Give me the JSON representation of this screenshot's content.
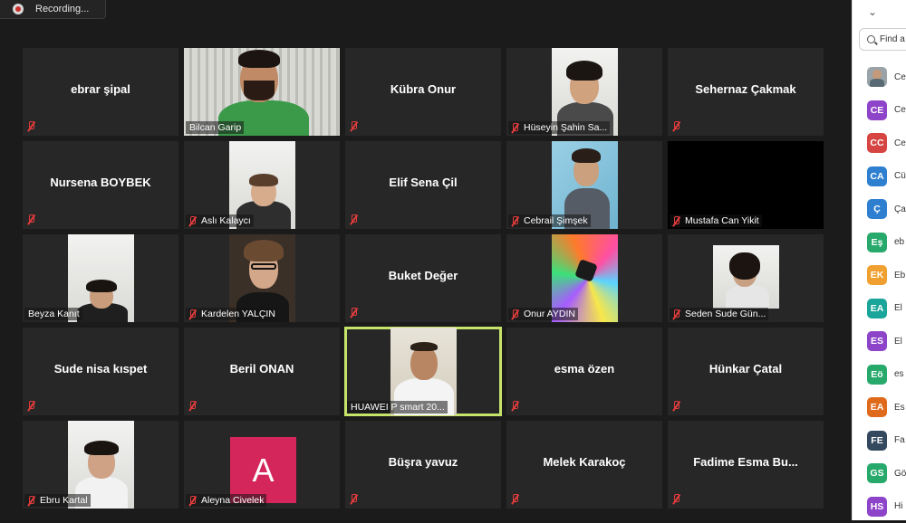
{
  "recording": {
    "label": "Recording..."
  },
  "tiles": [
    {
      "name": "ebrar  şipal"
    },
    {
      "name": "Bilcan Garip"
    },
    {
      "name": "Kübra Onur"
    },
    {
      "name": "Hüseyin Şahin Sa..."
    },
    {
      "name": "Sehernaz Çakmak"
    },
    {
      "name": "Nursena BOYBEK"
    },
    {
      "name": "Aslı Kalaycı"
    },
    {
      "name": "Elif Sena Çil"
    },
    {
      "name": "Cebrail Şimşek"
    },
    {
      "name": "Mustafa Can Yikit"
    },
    {
      "name": "Beyza  Kanıt"
    },
    {
      "name": "Kardelen YALÇIN"
    },
    {
      "name": "Buket Değer"
    },
    {
      "name": "Onur AYDIN"
    },
    {
      "name": "Seden Sude Gün..."
    },
    {
      "name": "Sude nisa kıspet"
    },
    {
      "name": "Beril ONAN"
    },
    {
      "name": "HUAWEI P smart 20..."
    },
    {
      "name": "esma özen"
    },
    {
      "name": "Hünkar Çatal"
    },
    {
      "name": "Ebru Kartal"
    },
    {
      "name": "Aleyna Civelek",
      "avatar_letter": "A"
    },
    {
      "name": "Büşra yavuz"
    },
    {
      "name": "Melek Karakoç"
    },
    {
      "name": "Fadime Esma Bu..."
    }
  ],
  "panel": {
    "search_placeholder": "Find a",
    "participants": [
      {
        "initials": "",
        "name": "Ce",
        "color": "#9aa3a8"
      },
      {
        "initials": "CE",
        "name": "Ce",
        "color": "#8e44c9"
      },
      {
        "initials": "CC",
        "name": "Ce",
        "color": "#d64541"
      },
      {
        "initials": "CA",
        "name": "Cü",
        "color": "#2f7fd0"
      },
      {
        "initials": "Ç",
        "name": "Ça",
        "color": "#2f7fd0"
      },
      {
        "initials": "Eş",
        "name": "eb",
        "color": "#27a96b"
      },
      {
        "initials": "EK",
        "name": "Eb",
        "color": "#f0a030"
      },
      {
        "initials": "EA",
        "name": "El",
        "color": "#1aa59a"
      },
      {
        "initials": "ES",
        "name": "El",
        "color": "#8e44c9"
      },
      {
        "initials": "Eö",
        "name": "es",
        "color": "#27a96b"
      },
      {
        "initials": "EA",
        "name": "Es",
        "color": "#e06a1c"
      },
      {
        "initials": "FE",
        "name": "Fa",
        "color": "#34495e"
      },
      {
        "initials": "GS",
        "name": "Gö",
        "color": "#27a96b"
      },
      {
        "initials": "HS",
        "name": "Hi",
        "color": "#8e44c9"
      }
    ]
  }
}
